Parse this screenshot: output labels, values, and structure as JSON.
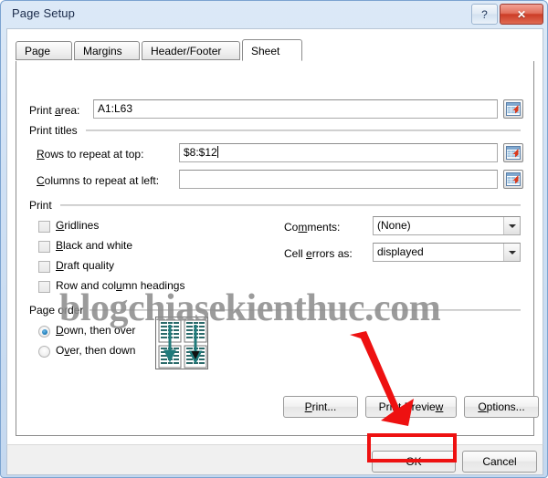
{
  "window": {
    "title": "Page Setup",
    "help_button": "?",
    "close_button": "✕"
  },
  "tabs": [
    {
      "label": "Page",
      "active": false
    },
    {
      "label": "Margins",
      "active": false
    },
    {
      "label": "Header/Footer",
      "active": false
    },
    {
      "label": "Sheet",
      "active": true
    }
  ],
  "sheet": {
    "print_area_label": "Print area:",
    "print_area_value": "A1:L63",
    "print_titles_group": "Print titles",
    "rows_repeat_label": "Rows to repeat at top:",
    "rows_repeat_value": "$8:$12",
    "cols_repeat_label": "Columns to repeat at left:",
    "cols_repeat_value": "",
    "print_group": "Print",
    "checkboxes": [
      {
        "label": "Gridlines",
        "checked": false
      },
      {
        "label": "Black and white",
        "checked": false
      },
      {
        "label": "Draft quality",
        "checked": false
      },
      {
        "label": "Row and column headings",
        "checked": false
      }
    ],
    "comments_label": "Comments:",
    "comments_value": "(None)",
    "cell_errors_label": "Cell errors as:",
    "cell_errors_value": "displayed",
    "page_order_group": "Page order",
    "page_order_options": [
      {
        "label": "Down, then over",
        "selected": true
      },
      {
        "label": "Over, then down",
        "selected": false
      }
    ]
  },
  "buttons": {
    "print": "Print...",
    "print_preview": "Print Preview",
    "options": "Options...",
    "ok": "OK",
    "cancel": "Cancel"
  },
  "annotations": {
    "watermark": "blogchiasekienthuc.com",
    "highlight_color": "#ee1111",
    "arrow_color": "#ee1111",
    "arrow_target": "ok-button"
  }
}
